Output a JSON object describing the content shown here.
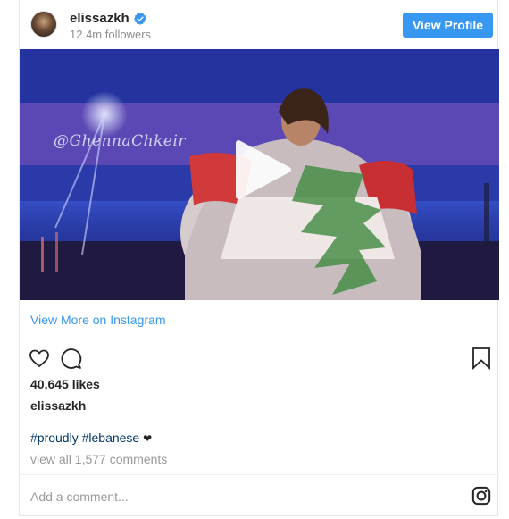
{
  "header": {
    "username": "elissazkh",
    "followers": "12.4m followers",
    "view_profile_label": "View Profile"
  },
  "media": {
    "watermark": "@GhennaChkeir",
    "type": "video"
  },
  "view_more_label": "View More on Instagram",
  "likes": "40,645 likes",
  "caption": {
    "username": "elissazkh",
    "hashtag_1": "#proudly",
    "hashtag_2": "#lebanese",
    "emoji": "❤"
  },
  "comments_link": "view all 1,577 comments",
  "comment_placeholder": "Add a comment...",
  "colors": {
    "accent": "#3897f0",
    "hashtag": "#003569",
    "muted": "#999999"
  }
}
